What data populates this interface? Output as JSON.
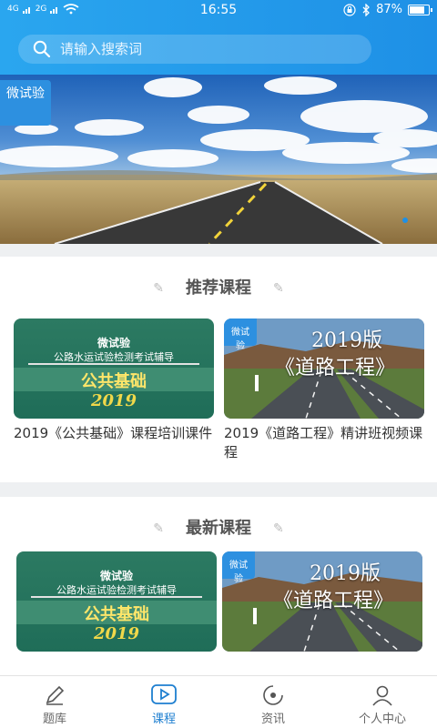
{
  "status_bar": {
    "signal_left": "4G",
    "signal_right": "2G",
    "time": "16:55",
    "battery": "87%",
    "battery_level": 0.87
  },
  "search": {
    "placeholder": "请输入搜索词"
  },
  "banner": {
    "tag": "微试验"
  },
  "recommended": {
    "title": "推荐课程",
    "courses": [
      {
        "caption": "2019《公共基础》课程培训课件",
        "thumb": {
          "brand": "微试验",
          "subtitle": "公路水运试验检测考试辅导",
          "subject": "公共基础",
          "year": "2019"
        }
      },
      {
        "caption": "2019《道路工程》精讲班视频课程",
        "thumb": {
          "tag": "微试验",
          "year": "2019版",
          "title": "《道路工程》"
        }
      }
    ]
  },
  "latest": {
    "title": "最新课程",
    "courses": [
      {
        "thumb": {
          "brand": "微试验",
          "subtitle": "公路水运试验检测考试辅导",
          "subject": "公共基础",
          "year": "2019"
        }
      },
      {
        "thumb": {
          "tag": "微试验",
          "year": "2019版",
          "title": "《道路工程》"
        }
      }
    ]
  },
  "bottom_nav": {
    "items": [
      {
        "label": "题库",
        "icon": "pencil-icon",
        "active": false
      },
      {
        "label": "课程",
        "icon": "play-icon",
        "active": true
      },
      {
        "label": "资讯",
        "icon": "news-icon",
        "active": false
      },
      {
        "label": "个人中心",
        "icon": "person-icon",
        "active": false
      }
    ]
  },
  "colors": {
    "primary": "#1e90e6",
    "active_nav": "#1e7fd0"
  }
}
